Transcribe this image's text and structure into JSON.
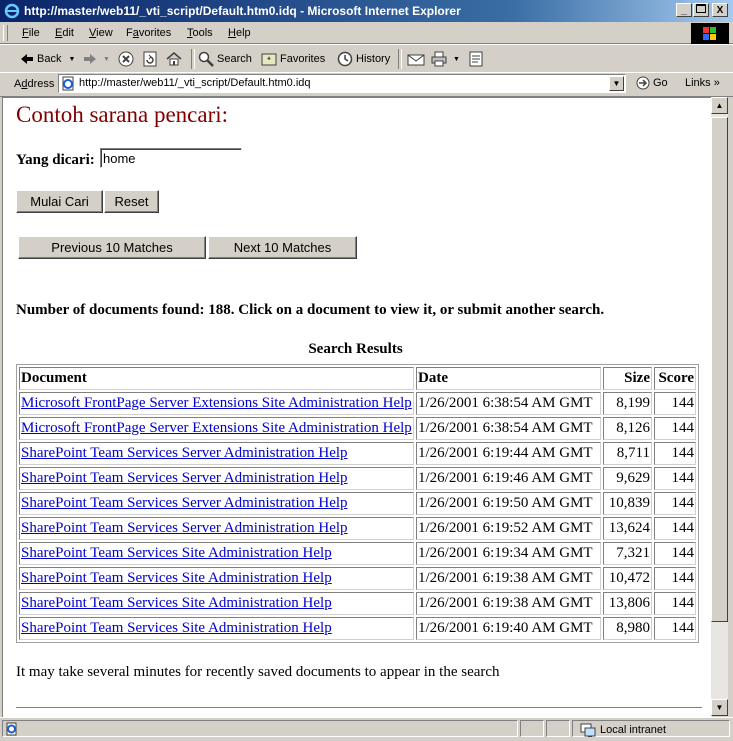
{
  "window": {
    "title": "http://master/web11/_vti_script/Default.htm0.idq - Microsoft Internet Explorer",
    "min_label": "_",
    "close_label": "X"
  },
  "menu": {
    "file_key": "F",
    "file_rest": "ile",
    "edit_key": "E",
    "edit_rest": "dit",
    "view_key": "V",
    "view_rest": "iew",
    "fav_pre": "F",
    "fav_key": "a",
    "fav_rest": "vorites",
    "tools_key": "T",
    "tools_rest": "ools",
    "help_key": "H",
    "help_rest": "elp"
  },
  "toolbar": {
    "back": "Back",
    "search": "Search",
    "favorites": "Favorites",
    "history": "History"
  },
  "address": {
    "label_key": "d",
    "label_pre": "A",
    "label_rest": "dress",
    "url": "http://master/web11/_vti_script/Default.htm0.idq",
    "go": "Go",
    "links": "Links"
  },
  "page": {
    "heading": "Contoh sarana pencari:",
    "search_label": "Yang dicari:",
    "search_value": "home",
    "submit": "Mulai Cari",
    "reset": "Reset",
    "prev": "Previous 10 Matches",
    "next": "Next 10 Matches",
    "found_text": "Number of documents found: 188. Click on a document to view it, or submit another search.",
    "results_caption": "Search Results",
    "columns": {
      "document": "Document",
      "date": "Date",
      "size": "Size",
      "score": "Score"
    },
    "rows": [
      {
        "doc": "Microsoft FrontPage Server Extensions Site Administration Help",
        "date": "1/26/2001 6:38:54 AM GMT",
        "size": "8,199",
        "score": "144"
      },
      {
        "doc": "Microsoft FrontPage Server Extensions Site Administration Help",
        "date": "1/26/2001 6:38:54 AM GMT",
        "size": "8,126",
        "score": "144"
      },
      {
        "doc": "SharePoint Team Services Server Administration Help",
        "date": "1/26/2001 6:19:44 AM GMT",
        "size": "8,711",
        "score": "144"
      },
      {
        "doc": "SharePoint Team Services Server Administration Help",
        "date": "1/26/2001 6:19:46 AM GMT",
        "size": "9,629",
        "score": "144"
      },
      {
        "doc": "SharePoint Team Services Server Administration Help",
        "date": "1/26/2001 6:19:50 AM GMT",
        "size": "10,839",
        "score": "144"
      },
      {
        "doc": "SharePoint Team Services Server Administration Help",
        "date": "1/26/2001 6:19:52 AM GMT",
        "size": "13,624",
        "score": "144"
      },
      {
        "doc": "SharePoint Team Services Site Administration Help",
        "date": "1/26/2001 6:19:34 AM GMT",
        "size": "7,321",
        "score": "144"
      },
      {
        "doc": "SharePoint Team Services Site Administration Help",
        "date": "1/26/2001 6:19:38 AM GMT",
        "size": "10,472",
        "score": "144"
      },
      {
        "doc": "SharePoint Team Services Site Administration Help",
        "date": "1/26/2001 6:19:38 AM GMT",
        "size": "13,806",
        "score": "144"
      },
      {
        "doc": "SharePoint Team Services Site Administration Help",
        "date": "1/26/2001 6:19:40 AM GMT",
        "size": "8,980",
        "score": "144"
      }
    ],
    "note": "It may take several minutes for recently saved documents to appear in the search"
  },
  "status": {
    "zone": "Local intranet"
  }
}
